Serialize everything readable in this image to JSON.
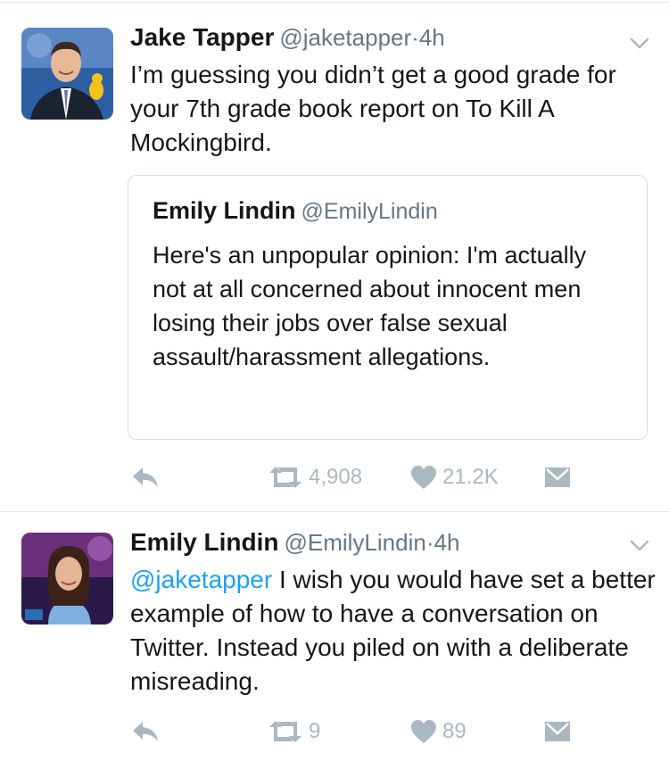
{
  "tweets": [
    {
      "name": "Jake Tapper",
      "handle": "@jaketapper",
      "separator": "·",
      "time": "4h",
      "text": "I’m guessing you didn’t get a good grade for your 7th grade book report on To Kill A Mockingbird.",
      "quoted": {
        "name": "Emily Lindin",
        "handle": "@EmilyLindin",
        "text": "Here's an unpopular opinion: I'm actually not at all concerned about innocent men losing their jobs over false sexual assault/harassment allegations."
      },
      "retweets": "4,908",
      "likes": "21.2K"
    },
    {
      "name": "Emily Lindin",
      "handle": "@EmilyLindin",
      "separator": "·",
      "time": "4h",
      "mention": "@jaketapper",
      "text": " I wish you would have set a better example of how to have a conversation on Twitter. Instead you piled on with a deliberate misreading.",
      "retweets": "9",
      "likes": "89"
    }
  ],
  "icons": {
    "reply": "reply-icon",
    "retweet": "retweet-icon",
    "like": "heart-icon",
    "dm": "envelope-icon",
    "caret": "chevron-down-icon"
  },
  "colors": {
    "text": "#14171a",
    "secondary": "#657786",
    "action": "#aab8c2",
    "link": "#1da1f2",
    "border": "#e1e8ed"
  }
}
